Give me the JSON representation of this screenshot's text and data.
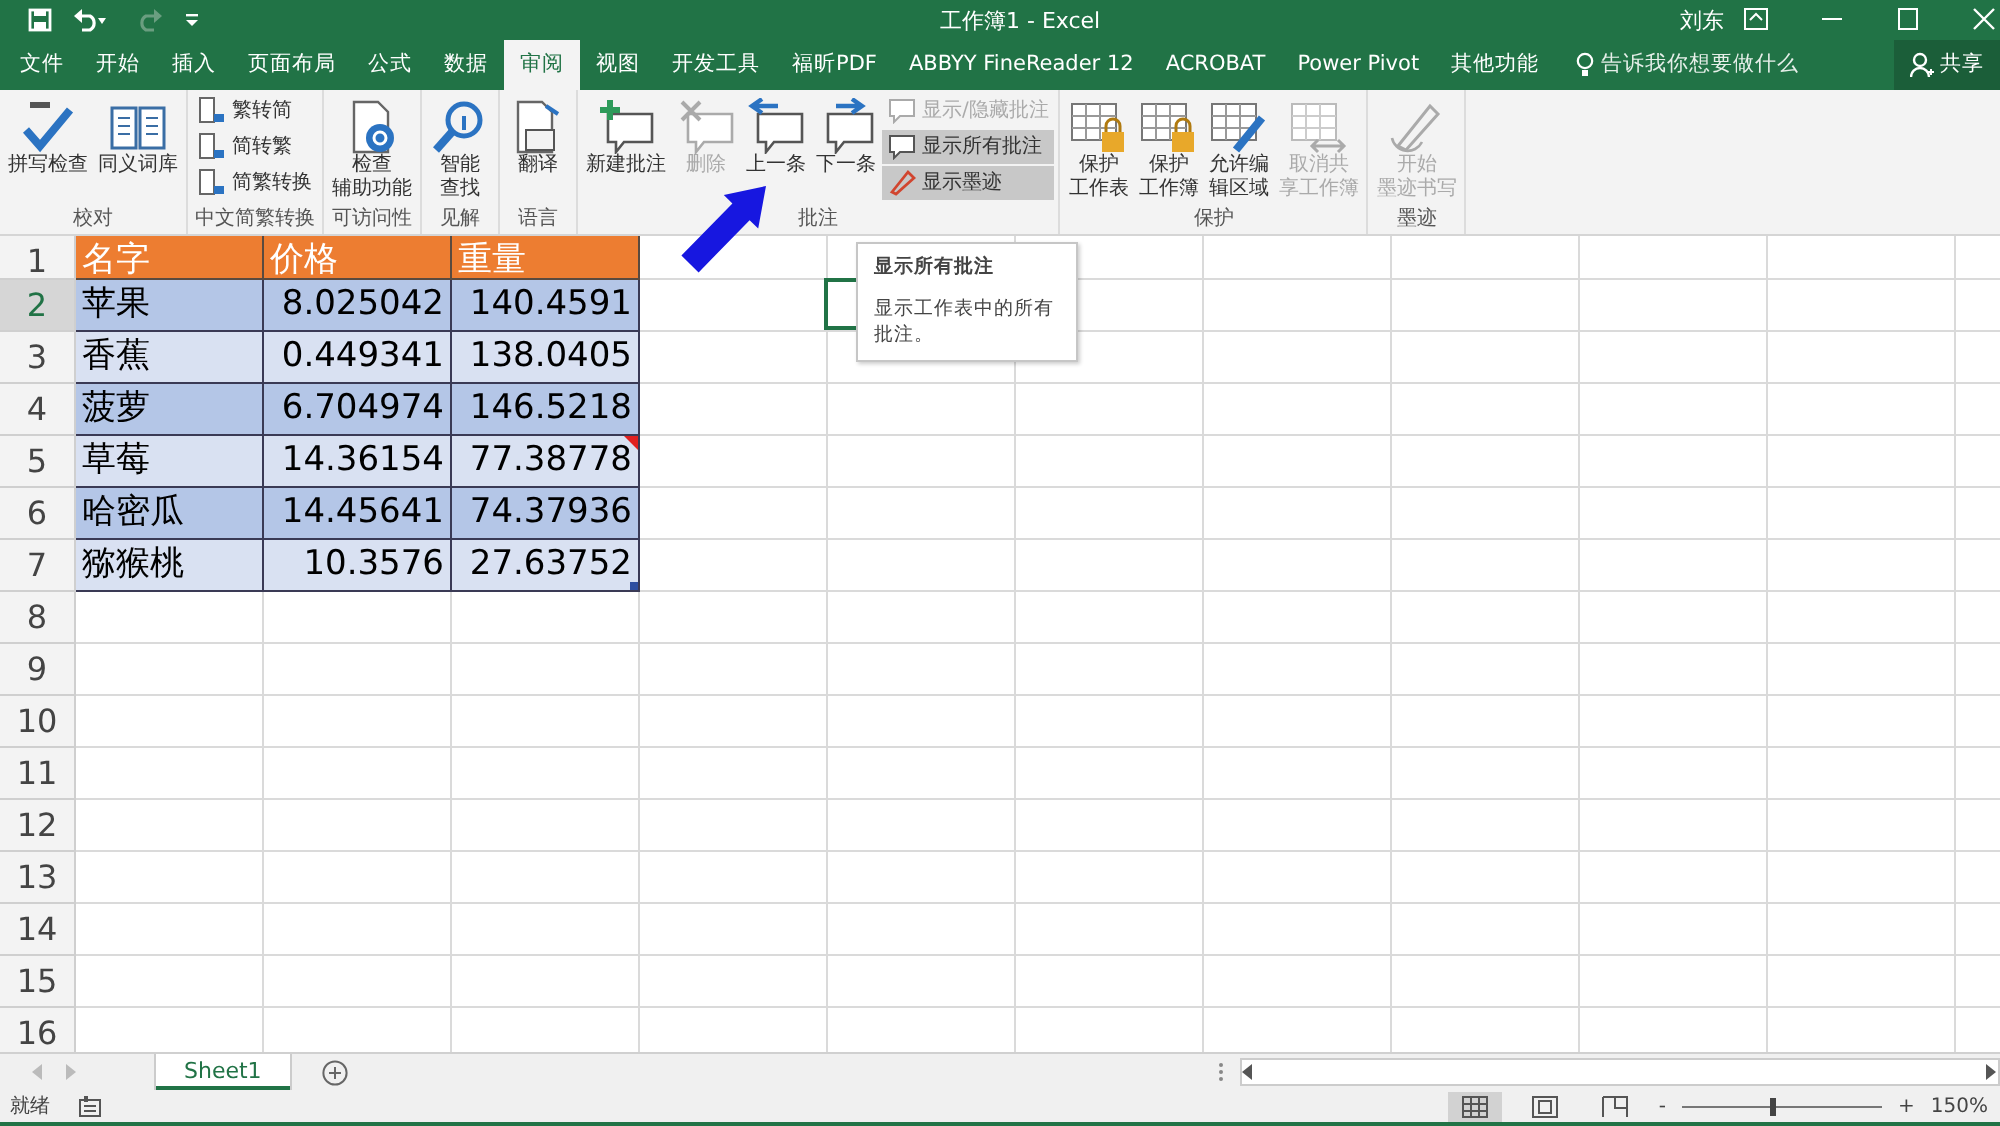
{
  "title_bar": {
    "title": "工作簿1 - Excel",
    "user": "刘东"
  },
  "tabs": [
    {
      "label": "文件",
      "selected": false
    },
    {
      "label": "开始",
      "selected": false
    },
    {
      "label": "插入",
      "selected": false
    },
    {
      "label": "页面布局",
      "selected": false
    },
    {
      "label": "公式",
      "selected": false
    },
    {
      "label": "数据",
      "selected": false
    },
    {
      "label": "审阅",
      "selected": true
    },
    {
      "label": "视图",
      "selected": false
    },
    {
      "label": "开发工具",
      "selected": false
    },
    {
      "label": "福昕PDF",
      "selected": false
    },
    {
      "label": "ABBYY FineReader 12",
      "selected": false
    },
    {
      "label": "ACROBAT",
      "selected": false
    },
    {
      "label": "Power Pivot",
      "selected": false
    },
    {
      "label": "其他功能",
      "selected": false
    }
  ],
  "tell_me": {
    "placeholder": "告诉我你想要做什么"
  },
  "share_button": "共享",
  "ribbon_groups": [
    {
      "label": "校对",
      "buttons": [
        {
          "kind": "large",
          "label": "拼写检查",
          "disabled": false,
          "pressed": false
        },
        {
          "kind": "large",
          "label": "同义词库",
          "disabled": false,
          "pressed": false
        }
      ]
    },
    {
      "label": "中文简繁转换",
      "buttons": [
        {
          "kind": "small",
          "label": "繁转简",
          "disabled": false,
          "pressed": false
        },
        {
          "kind": "small",
          "label": "简转繁",
          "disabled": false,
          "pressed": false
        },
        {
          "kind": "small",
          "label": "简繁转换",
          "disabled": false,
          "pressed": false
        }
      ]
    },
    {
      "label": "可访问性",
      "buttons": [
        {
          "kind": "large",
          "label_lines": [
            "检查",
            "辅助功能"
          ],
          "disabled": false,
          "pressed": false
        }
      ]
    },
    {
      "label": "见解",
      "buttons": [
        {
          "kind": "large",
          "label_lines": [
            "智能",
            "查找"
          ],
          "disabled": false,
          "pressed": false
        }
      ]
    },
    {
      "label": "语言",
      "buttons": [
        {
          "kind": "large",
          "label": "翻译",
          "disabled": false,
          "pressed": false
        }
      ]
    },
    {
      "label": "批注",
      "buttons": [
        {
          "kind": "large",
          "label": "新建批注",
          "disabled": false,
          "pressed": false
        },
        {
          "kind": "large",
          "label": "删除",
          "disabled": true,
          "pressed": false
        },
        {
          "kind": "large",
          "label": "上一条",
          "disabled": false,
          "pressed": false
        },
        {
          "kind": "large",
          "label": "下一条",
          "disabled": false,
          "pressed": false
        },
        {
          "kind": "small",
          "label": "显示/隐藏批注",
          "disabled": true,
          "pressed": false
        },
        {
          "kind": "small",
          "label": "显示所有批注",
          "disabled": false,
          "pressed": true
        },
        {
          "kind": "small",
          "label": "显示墨迹",
          "disabled": false,
          "pressed": true
        }
      ]
    },
    {
      "label": "保护",
      "buttons": [
        {
          "kind": "large",
          "label_lines": [
            "保护",
            "工作表"
          ],
          "disabled": false,
          "pressed": false
        },
        {
          "kind": "large",
          "label_lines": [
            "保护",
            "工作簿"
          ],
          "disabled": false,
          "pressed": false
        },
        {
          "kind": "large",
          "label_lines": [
            "允许编",
            "辑区域"
          ],
          "disabled": false,
          "pressed": false
        },
        {
          "kind": "large",
          "label_lines": [
            "取消共",
            "享工作簿"
          ],
          "disabled": true,
          "pressed": false
        }
      ]
    },
    {
      "label": "墨迹",
      "buttons": [
        {
          "kind": "large",
          "label_lines": [
            "开始",
            "墨迹书写"
          ],
          "disabled": true,
          "pressed": false
        }
      ]
    }
  ],
  "sheet": {
    "columns": [
      "名字",
      "价格",
      "重量"
    ],
    "rows": [
      {
        "cells": [
          "苹果",
          "8.025042",
          "140.4591"
        ],
        "comment": false
      },
      {
        "cells": [
          "香蕉",
          "0.449341",
          "138.0405"
        ],
        "comment": false
      },
      {
        "cells": [
          "菠萝",
          "6.704974",
          "146.5218"
        ],
        "comment": false
      },
      {
        "cells": [
          "草莓",
          "14.36154",
          "77.38778"
        ],
        "comment": true
      },
      {
        "cells": [
          "哈密瓜",
          "14.45641",
          "74.37936"
        ],
        "comment": false
      },
      {
        "cells": [
          "猕猴桃",
          "10.3576",
          "27.63752"
        ],
        "comment": false
      }
    ],
    "row_headers": [
      {
        "label": "1",
        "selected": false
      },
      {
        "label": "2",
        "selected": true
      },
      {
        "label": "3",
        "selected": false
      },
      {
        "label": "4",
        "selected": false
      },
      {
        "label": "5",
        "selected": false
      },
      {
        "label": "6",
        "selected": false
      },
      {
        "label": "7",
        "selected": false
      },
      {
        "label": "8",
        "selected": false
      },
      {
        "label": "9",
        "selected": false
      },
      {
        "label": "10",
        "selected": false
      },
      {
        "label": "11",
        "selected": false
      },
      {
        "label": "12",
        "selected": false
      },
      {
        "label": "13",
        "selected": false
      },
      {
        "label": "14",
        "selected": false
      },
      {
        "label": "15",
        "selected": false
      },
      {
        "label": "16",
        "selected": false
      }
    ]
  },
  "tooltip": {
    "title": "显示所有批注",
    "text": "显示工作表中的所有批注。"
  },
  "sheet_tabs": [
    {
      "label": "Sheet1",
      "selected": true
    }
  ],
  "status_bar": {
    "text": "就绪",
    "views": [
      {
        "selected": true
      },
      {
        "selected": false
      },
      {
        "selected": false
      }
    ],
    "zoom": {
      "minus": "-",
      "plus": "+",
      "level": 0.45,
      "reading": "150%"
    }
  }
}
